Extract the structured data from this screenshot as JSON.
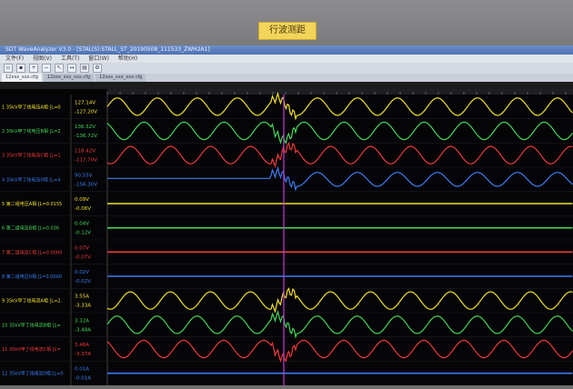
{
  "sign": {
    "text": "行波测距"
  },
  "window": {
    "title": "SDT WaveAnalyzer V3.0 - [STAL(S):STALL_ST_20190508_111533_ZWH2A1]",
    "menu": [
      "文件(F)",
      "视图(V)",
      "工具(T)",
      "窗口(W)",
      "帮助(H)"
    ]
  },
  "tabs": [
    "12xxx_xxx.cfg",
    "12xxx_xxx_xxx.cfg",
    "12xxx_xxx_xxx.cfg"
  ],
  "colors": {
    "yellow": "#f2e12a",
    "green": "#47d65a",
    "red": "#ee3a3a",
    "blue": "#3a7cf2",
    "cursor": "#c23fd6"
  },
  "channels": [
    {
      "name": "1 35kV甲丁线电压A相 [L=0",
      "max": "127.14V",
      "min": "-127.20V",
      "color": "yellow",
      "wave": "sine"
    },
    {
      "name": "2 35kV甲丁线电压B相 [L=2",
      "max": "136.52V",
      "min": "-136.72V",
      "color": "green",
      "wave": "sine"
    },
    {
      "name": "3 35kV甲丁线电压C相 [L=1",
      "max": "118.42V",
      "min": "-117.70V",
      "color": "red",
      "wave": "sine"
    },
    {
      "name": "4 35kV甲丁线电压0相 [L=4",
      "max": "90.55V",
      "min": "-156.30V",
      "color": "blue",
      "wave": "half"
    },
    {
      "name": "5 第二组电压A相 [L=0.0155",
      "max": "0.09V",
      "min": "-0.06V",
      "color": "yellow",
      "wave": "flat"
    },
    {
      "name": "6 第二组电压B相 [L=0.036",
      "max": "0.04V",
      "min": "-0.12V",
      "color": "green",
      "wave": "flat"
    },
    {
      "name": "7 第二组电压C相 [L=0.0000",
      "max": "0.07V",
      "min": "-0.07V",
      "color": "red",
      "wave": "flat"
    },
    {
      "name": "8 第二组电压0相 [L=0.0000",
      "max": "0.02V",
      "min": "-0.02V",
      "color": "blue",
      "wave": "flat"
    },
    {
      "name": "9 35kV甲丁线电流A相 [L=2.",
      "max": "3.55A",
      "min": "-3.33A",
      "color": "yellow",
      "wave": "sine"
    },
    {
      "name": "10 35kV甲丁线电流B相 [L=",
      "max": "3.32A",
      "min": "-3.48A",
      "color": "green",
      "wave": "sine"
    },
    {
      "name": "11 35kV甲丁线电流C相 [L=",
      "max": "3.46A",
      "min": "-3.37A",
      "color": "red",
      "wave": "sine"
    },
    {
      "name": "12 35kV甲丁线电流0相 [L=0",
      "max": "0.01A",
      "min": "-0.01A",
      "color": "blue",
      "wave": "flat"
    }
  ]
}
